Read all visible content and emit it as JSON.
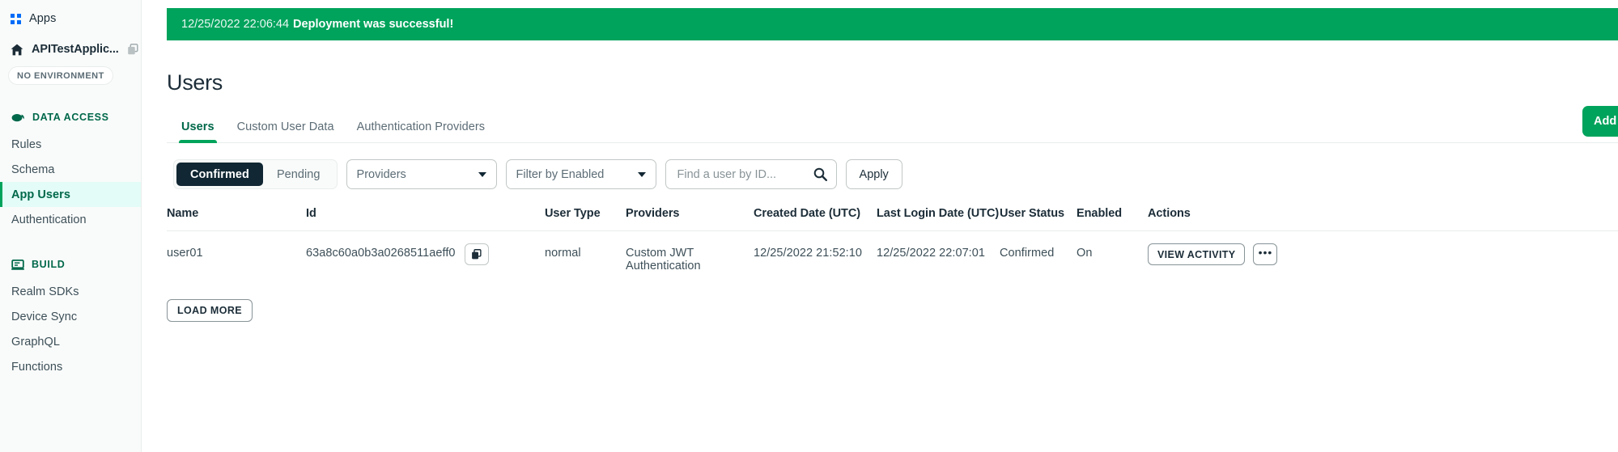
{
  "sidebar": {
    "apps_label": "Apps",
    "app_name": "APITestApplic...",
    "environment_badge": "NO ENVIRONMENT",
    "sections": [
      {
        "title": "DATA ACCESS",
        "icon": "cloud-icon",
        "items": [
          {
            "label": "Rules",
            "active": false
          },
          {
            "label": "Schema",
            "active": false
          },
          {
            "label": "App Users",
            "active": true
          },
          {
            "label": "Authentication",
            "active": false
          }
        ]
      },
      {
        "title": "BUILD",
        "icon": "laptop-icon",
        "items": [
          {
            "label": "Realm SDKs",
            "active": false
          },
          {
            "label": "Device Sync",
            "active": false
          },
          {
            "label": "GraphQL",
            "active": false
          },
          {
            "label": "Functions",
            "active": false
          }
        ]
      }
    ]
  },
  "banner": {
    "timestamp": "12/25/2022 22:06:44",
    "message": "Deployment was successful!",
    "color": "#00A35C"
  },
  "page": {
    "title": "Users",
    "add_button_label": "Add"
  },
  "tabs": [
    {
      "label": "Users",
      "active": true
    },
    {
      "label": "Custom User Data",
      "active": false
    },
    {
      "label": "Authentication Providers",
      "active": false
    }
  ],
  "filters": {
    "segments": [
      {
        "label": "Confirmed",
        "selected": true
      },
      {
        "label": "Pending",
        "selected": false
      }
    ],
    "providers_select": "Providers",
    "enabled_select": "Filter by Enabled",
    "search_placeholder": "Find a user by ID...",
    "search_value": "",
    "apply_label": "Apply"
  },
  "table": {
    "columns": [
      "Name",
      "Id",
      "User Type",
      "Providers",
      "Created Date (UTC)",
      "Last Login Date (UTC)",
      "User Status",
      "Enabled",
      "Actions"
    ],
    "rows": [
      {
        "name": "user01",
        "id": "63a8c60a0b3a0268511aeff0",
        "user_type": "normal",
        "providers": "Custom JWT Authentication",
        "created_date": "12/25/2022 21:52:10",
        "last_login_date": "12/25/2022 22:07:01",
        "user_status": "Confirmed",
        "enabled": "On",
        "view_activity_label": "VIEW ACTIVITY",
        "more_label": "•••"
      }
    ],
    "load_more_label": "LOAD MORE"
  }
}
